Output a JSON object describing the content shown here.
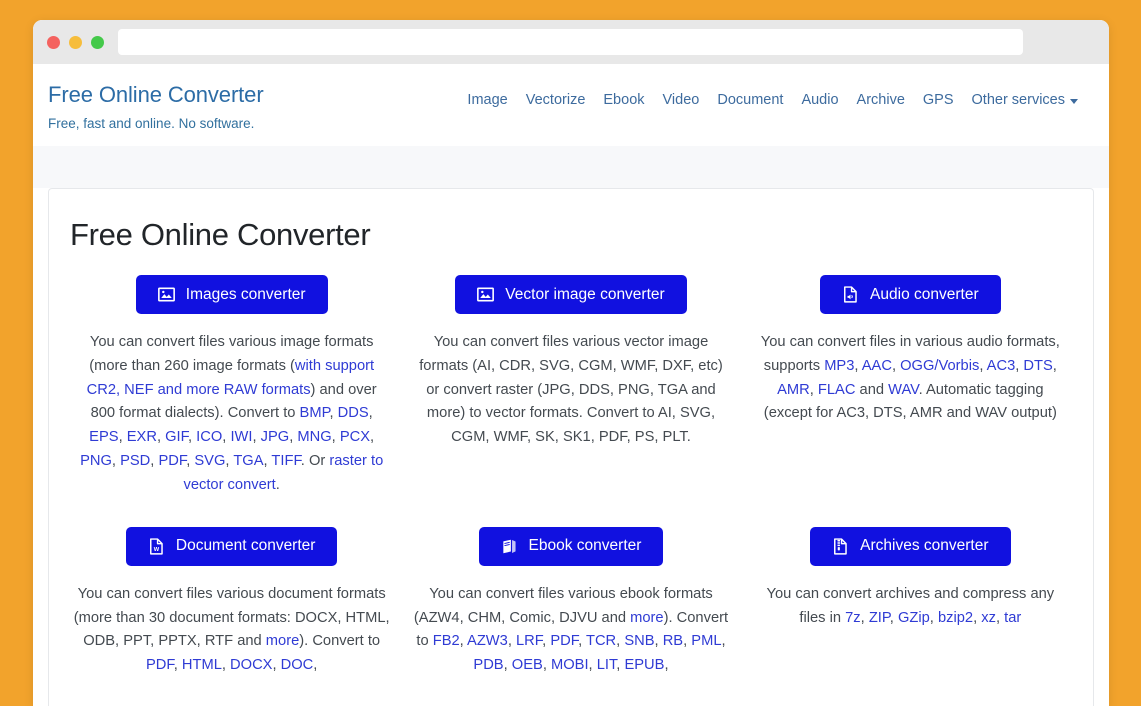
{
  "browser": {
    "url_value": "",
    "url_placeholder": "",
    "traffic_lights": [
      "close-red",
      "minimize-yellow",
      "maximize-green"
    ]
  },
  "colors": {
    "page_background": "#f2a32c",
    "brand_blue": "#2c6ca6",
    "button_blue": "#1111e0",
    "link_blue": "#2f3bd4",
    "band_grey": "#f7f8fa"
  },
  "header": {
    "brand_title": "Free Online Converter",
    "brand_tagline": "Free, fast and online. No software.",
    "nav": [
      {
        "label": "Image"
      },
      {
        "label": "Vectorize"
      },
      {
        "label": "Ebook"
      },
      {
        "label": "Video"
      },
      {
        "label": "Document"
      },
      {
        "label": "Audio"
      },
      {
        "label": "Archive"
      },
      {
        "label": "GPS"
      }
    ],
    "nav_dropdown": {
      "label": "Other services",
      "icon": "chevron-down-icon"
    }
  },
  "main": {
    "page_title": "Free Online Converter",
    "cards": [
      {
        "id": "images",
        "button_label": "Images converter",
        "icon": "image-icon",
        "description_segments": [
          {
            "text": "You can convert files various image formats (more than 260 image formats (",
            "link": false
          },
          {
            "text": "with support CR2, NEF and more RAW formats",
            "link": true
          },
          {
            "text": ") and over 800 format dialects). Convert to ",
            "link": false
          },
          {
            "text": "BMP",
            "link": true
          },
          {
            "text": ", ",
            "link": false
          },
          {
            "text": "DDS",
            "link": true
          },
          {
            "text": ", ",
            "link": false
          },
          {
            "text": "EPS",
            "link": true
          },
          {
            "text": ", ",
            "link": false
          },
          {
            "text": "EXR",
            "link": true
          },
          {
            "text": ", ",
            "link": false
          },
          {
            "text": "GIF",
            "link": true
          },
          {
            "text": ", ",
            "link": false
          },
          {
            "text": "ICO",
            "link": true
          },
          {
            "text": ", ",
            "link": false
          },
          {
            "text": "IWI",
            "link": true
          },
          {
            "text": ", ",
            "link": false
          },
          {
            "text": "JPG",
            "link": true
          },
          {
            "text": ", ",
            "link": false
          },
          {
            "text": "MNG",
            "link": true
          },
          {
            "text": ", ",
            "link": false
          },
          {
            "text": "PCX",
            "link": true
          },
          {
            "text": ", ",
            "link": false
          },
          {
            "text": "PNG",
            "link": true
          },
          {
            "text": ", ",
            "link": false
          },
          {
            "text": "PSD",
            "link": true
          },
          {
            "text": ", ",
            "link": false
          },
          {
            "text": "PDF",
            "link": true
          },
          {
            "text": ", ",
            "link": false
          },
          {
            "text": "SVG",
            "link": true
          },
          {
            "text": ", ",
            "link": false
          },
          {
            "text": "TGA",
            "link": true
          },
          {
            "text": ", ",
            "link": false
          },
          {
            "text": "TIFF",
            "link": true
          },
          {
            "text": ". Or ",
            "link": false
          },
          {
            "text": "raster to vector convert",
            "link": true
          },
          {
            "text": ".",
            "link": false
          }
        ]
      },
      {
        "id": "vector",
        "button_label": "Vector image converter",
        "icon": "image-icon",
        "description_segments": [
          {
            "text": "You can convert files various vector image formats (AI, CDR, SVG, CGM, WMF, DXF, etc) or convert raster (JPG, DDS, PNG, TGA and more) to vector formats. Convert to AI, SVG, CGM, WMF, SK, SK1, PDF, PS, PLT.",
            "link": false
          }
        ]
      },
      {
        "id": "audio",
        "button_label": "Audio converter",
        "icon": "audio-file-icon",
        "description_segments": [
          {
            "text": "You can convert files in various audio formats, supports ",
            "link": false
          },
          {
            "text": "MP3",
            "link": true
          },
          {
            "text": ", ",
            "link": false
          },
          {
            "text": "AAC",
            "link": true
          },
          {
            "text": ", ",
            "link": false
          },
          {
            "text": "OGG/Vorbis",
            "link": true
          },
          {
            "text": ", ",
            "link": false
          },
          {
            "text": "AC3",
            "link": true
          },
          {
            "text": ", ",
            "link": false
          },
          {
            "text": "DTS",
            "link": true
          },
          {
            "text": ", ",
            "link": false
          },
          {
            "text": "AMR",
            "link": true
          },
          {
            "text": ", ",
            "link": false
          },
          {
            "text": "FLAC",
            "link": true
          },
          {
            "text": " and ",
            "link": false
          },
          {
            "text": "WAV",
            "link": true
          },
          {
            "text": ". Automatic tagging (except for AC3, DTS, AMR and WAV output)",
            "link": false
          }
        ]
      },
      {
        "id": "document",
        "button_label": "Document converter",
        "icon": "word-document-icon",
        "description_segments": [
          {
            "text": "You can convert files various document formats (more than 30 document formats: DOCX, HTML, ODB, PPT, PPTX, RTF and ",
            "link": false
          },
          {
            "text": "more",
            "link": true
          },
          {
            "text": "). Convert to ",
            "link": false
          },
          {
            "text": "PDF",
            "link": true
          },
          {
            "text": ", ",
            "link": false
          },
          {
            "text": "HTML",
            "link": true
          },
          {
            "text": ", ",
            "link": false
          },
          {
            "text": "DOCX",
            "link": true
          },
          {
            "text": ", ",
            "link": false
          },
          {
            "text": "DOC",
            "link": true
          },
          {
            "text": ",",
            "link": false
          }
        ]
      },
      {
        "id": "ebook",
        "button_label": "Ebook converter",
        "icon": "book-icon",
        "description_segments": [
          {
            "text": "You can convert files various ebook formats (AZW4, CHM, Comic, DJVU and ",
            "link": false
          },
          {
            "text": "more",
            "link": true
          },
          {
            "text": "). Convert to ",
            "link": false
          },
          {
            "text": "FB2",
            "link": true
          },
          {
            "text": ", ",
            "link": false
          },
          {
            "text": "AZW3",
            "link": true
          },
          {
            "text": ", ",
            "link": false
          },
          {
            "text": "LRF",
            "link": true
          },
          {
            "text": ", ",
            "link": false
          },
          {
            "text": "PDF",
            "link": true
          },
          {
            "text": ", ",
            "link": false
          },
          {
            "text": "TCR",
            "link": true
          },
          {
            "text": ", ",
            "link": false
          },
          {
            "text": "SNB",
            "link": true
          },
          {
            "text": ", ",
            "link": false
          },
          {
            "text": "RB",
            "link": true
          },
          {
            "text": ", ",
            "link": false
          },
          {
            "text": "PML",
            "link": true
          },
          {
            "text": ", ",
            "link": false
          },
          {
            "text": "PDB",
            "link": true
          },
          {
            "text": ", ",
            "link": false
          },
          {
            "text": "OEB",
            "link": true
          },
          {
            "text": ", ",
            "link": false
          },
          {
            "text": "MOBI",
            "link": true
          },
          {
            "text": ", ",
            "link": false
          },
          {
            "text": "LIT",
            "link": true
          },
          {
            "text": ", ",
            "link": false
          },
          {
            "text": "EPUB",
            "link": true
          },
          {
            "text": ",",
            "link": false
          }
        ]
      },
      {
        "id": "archives",
        "button_label": "Archives converter",
        "icon": "archive-file-icon",
        "description_segments": [
          {
            "text": "You can convert archives and compress any files in ",
            "link": false
          },
          {
            "text": "7z",
            "link": true
          },
          {
            "text": ", ",
            "link": false
          },
          {
            "text": "ZIP",
            "link": true
          },
          {
            "text": ", ",
            "link": false
          },
          {
            "text": "GZip",
            "link": true
          },
          {
            "text": ", ",
            "link": false
          },
          {
            "text": "bzip2",
            "link": true
          },
          {
            "text": ", ",
            "link": false
          },
          {
            "text": "xz",
            "link": true
          },
          {
            "text": ", ",
            "link": false
          },
          {
            "text": "tar",
            "link": true
          }
        ]
      }
    ]
  }
}
